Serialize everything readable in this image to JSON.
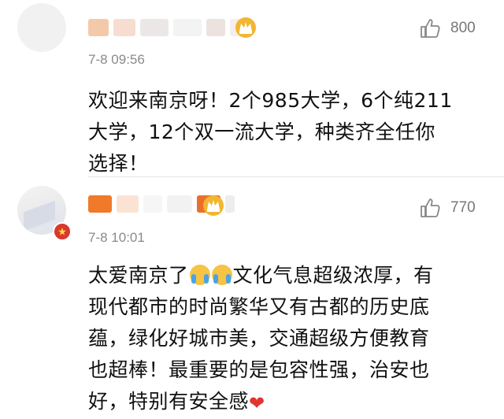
{
  "comments": [
    {
      "time": "7-8 09:56",
      "likes": "800",
      "text_lines": [
        "欢迎来南京呀！2个985大学，6个纯211",
        "大学，12个双一流大学，种类齐全任你",
        "选择！"
      ]
    },
    {
      "time": "7-8 10:01",
      "likes": "770",
      "text_line1_before": "太爱南京了",
      "text_line1_after": "文化气息超级浓厚，有",
      "text_lines": [
        "现代都市的时尚繁华又有古都的历史底",
        "蕴，绿化好城市美，交通超级方便教育",
        "也超棒！最重要的是包容性强，治安也"
      ],
      "text_last_line": "好，特别有安全感"
    }
  ],
  "icons": {
    "like": "thumbs-up-icon",
    "vip_badge": "crown-badge-icon",
    "crying_emoji": "loudly-crying-face-icon",
    "heart": "red-heart-icon"
  },
  "colors": {
    "text": "#111111",
    "meta": "#8a8a8a",
    "badge_gold": "#f2b632",
    "badge_red": "#d8392c",
    "heart": "#e0362f"
  }
}
